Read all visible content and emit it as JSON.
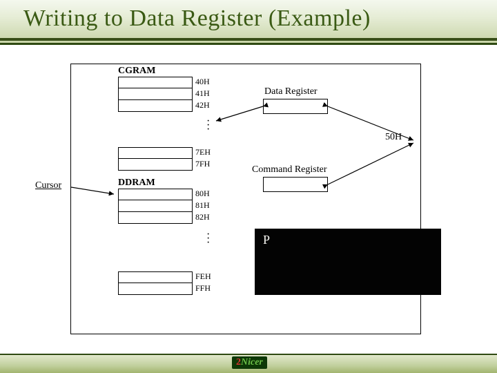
{
  "title": "Writing to Data Register (Example)",
  "cgram": {
    "label": "CGRAM",
    "top_addrs": [
      "40H",
      "41H",
      "42H"
    ],
    "bottom_addrs": [
      "7EH",
      "7FH"
    ]
  },
  "ddram": {
    "label": "DDRAM",
    "top_addrs": [
      "80H",
      "81H",
      "82H"
    ],
    "bottom_addrs": [
      "FEH",
      "FFH"
    ]
  },
  "data_register_label": "Data Register",
  "command_register_label": "Command Register",
  "bus_value": "50H",
  "cursor_label": "Cursor",
  "panel_text": "P",
  "footer_brand": "Nicer",
  "footer_glyph": "2",
  "chart_data": {
    "type": "table",
    "title": "LCD memory map and register write example",
    "memory_blocks": [
      {
        "name": "CGRAM",
        "range_start_hex": "40H",
        "range_end_hex": "7FH",
        "shown_addresses": [
          "40H",
          "41H",
          "42H",
          "7EH",
          "7FH"
        ]
      },
      {
        "name": "DDRAM",
        "range_start_hex": "80H",
        "range_end_hex": "FFH",
        "shown_addresses": [
          "80H",
          "81H",
          "82H",
          "FEH",
          "FFH"
        ]
      }
    ],
    "registers": [
      "Data Register",
      "Command Register"
    ],
    "incoming_value_hex": "50H",
    "cursor_points_to": "DDRAM"
  }
}
